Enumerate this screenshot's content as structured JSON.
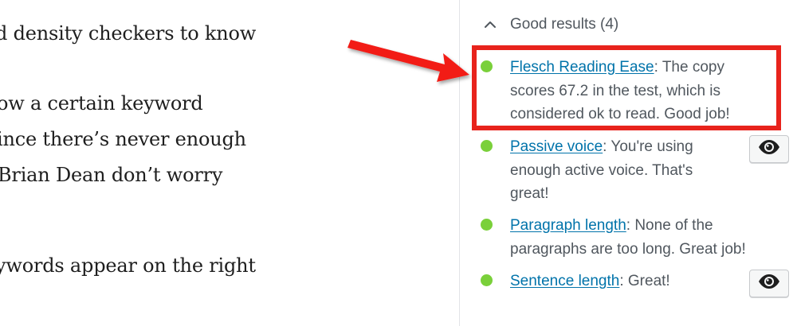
{
  "editor": {
    "lines": [
      "d density checkers to know",
      "ow a certain keyword",
      "ince there’s never enough",
      " Brian Dean don’t worry",
      "ywords appear on the right"
    ]
  },
  "sidebar": {
    "header": {
      "chevron_icon": "chevron-up-icon",
      "title": "Good results (4)"
    },
    "results": [
      {
        "link": "Flesch Reading Ease",
        "lines": [
          ": The copy",
          "scores 67.2 in the test, which is",
          "considered ok to read. Good job!"
        ],
        "status_color": "#7ad03a",
        "highlighted": true,
        "has_eye_button": false
      },
      {
        "link": "Passive voice",
        "lines": [
          ": You're using",
          "enough active voice. That's",
          "great!"
        ],
        "status_color": "#7ad03a",
        "highlighted": false,
        "has_eye_button": true,
        "eye_icon": "eye-icon"
      },
      {
        "link": "Paragraph length",
        "lines": [
          ": None of the",
          "paragraphs are too long. Great job!"
        ],
        "status_color": "#7ad03a",
        "highlighted": false,
        "has_eye_button": false
      },
      {
        "link": "Sentence length",
        "lines": [
          ": Great!"
        ],
        "status_color": "#7ad03a",
        "highlighted": false,
        "has_eye_button": true,
        "eye_icon": "eye-icon"
      }
    ]
  },
  "annotation": {
    "highlight_color": "#e8231c",
    "arrow_color": "#f21b16"
  }
}
